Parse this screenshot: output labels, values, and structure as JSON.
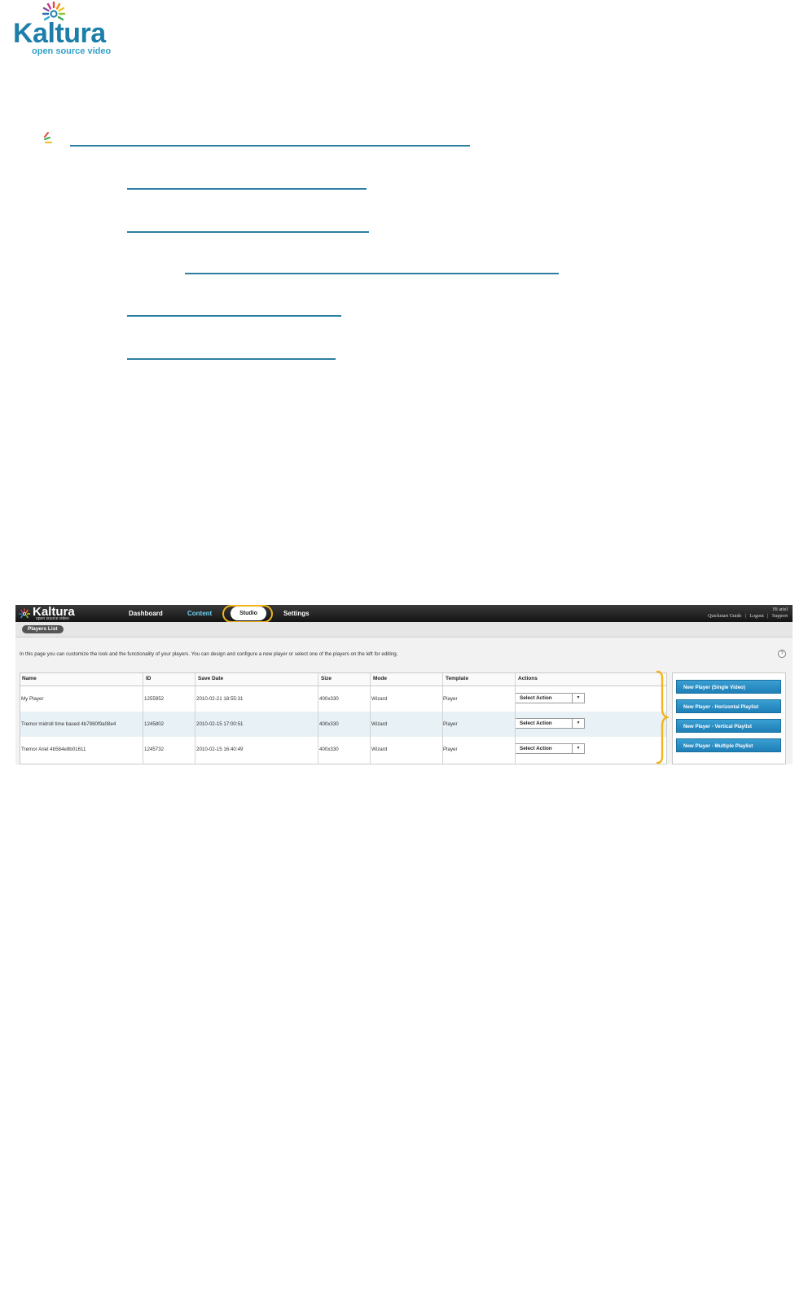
{
  "logo": {
    "word": "Kaltura",
    "tagline": "open source video"
  },
  "kmc": {
    "logo": {
      "word": "Kaltura",
      "tagline": "open source video"
    },
    "nav": {
      "dashboard": "Dashboard",
      "content": "Content",
      "studio": "Studio",
      "settings": "Settings"
    },
    "top_right": {
      "greeting": "Hi ariel",
      "quickstart": "Quickstart Guide",
      "logout": "Logout",
      "support": "Support",
      "sep": "|"
    },
    "tab": "Players List",
    "intro": "In this page you can customize the look and the functionality of your players. You can design and configure a new player or select one of the players on the left for editing.",
    "help": "?",
    "table": {
      "columns": [
        "Name",
        "ID",
        "Save Date",
        "Size",
        "Mode",
        "Template",
        "Actions"
      ],
      "rows": [
        {
          "name": "My Player",
          "id": "1255952",
          "date": "2010-02-21 18:55:31",
          "size": "400x330",
          "mode": "Wizard",
          "template": "Player",
          "action": "Select Action"
        },
        {
          "name": "Tremor midroll time based 4b7980f9a08e4",
          "id": "1245802",
          "date": "2010-02-15 17:00:51",
          "size": "400x330",
          "mode": "Wizard",
          "template": "Player",
          "action": "Select Action"
        },
        {
          "name": "Tremor Ariel 4b584e8b01611",
          "id": "1245732",
          "date": "2010-02-15 16:40:49",
          "size": "400x330",
          "mode": "Wizard",
          "template": "Player",
          "action": "Select Action"
        }
      ]
    },
    "buttons": [
      "New Player (Single Video)",
      "New Player - Horizontal Playlist",
      "New Player - Vertical Playlist",
      "New Player - Multiple Playlist"
    ]
  },
  "colors": {
    "brand": "#1d7fa9",
    "link": "#2c7fa3",
    "highlight": "#f2b41a",
    "button": "#2a8fc6"
  }
}
